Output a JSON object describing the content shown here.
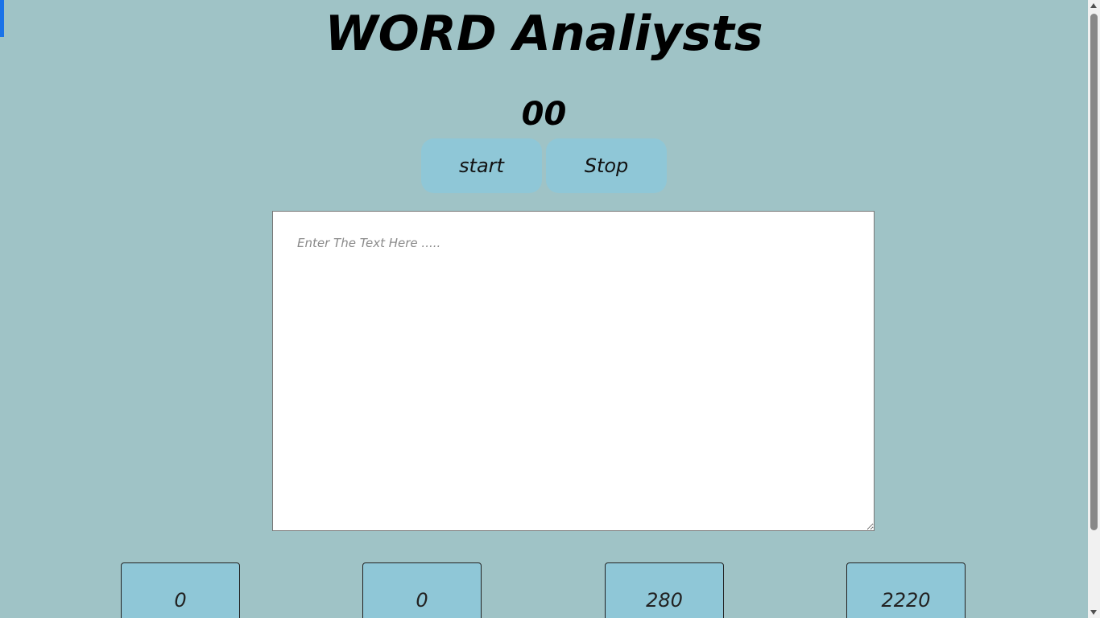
{
  "header": {
    "title": "WORD Analiysts"
  },
  "timer": {
    "value": "00"
  },
  "controls": {
    "start_label": "start",
    "stop_label": "Stop"
  },
  "editor": {
    "placeholder": "Enter The Text Here .....",
    "value": ""
  },
  "stats": [
    {
      "value": "0"
    },
    {
      "value": "0"
    },
    {
      "value": "280"
    },
    {
      "value": "2220"
    }
  ],
  "colors": {
    "background": "#9fc3c6",
    "button": "#8fc7d7",
    "accent_marker": "#1a73e8"
  }
}
